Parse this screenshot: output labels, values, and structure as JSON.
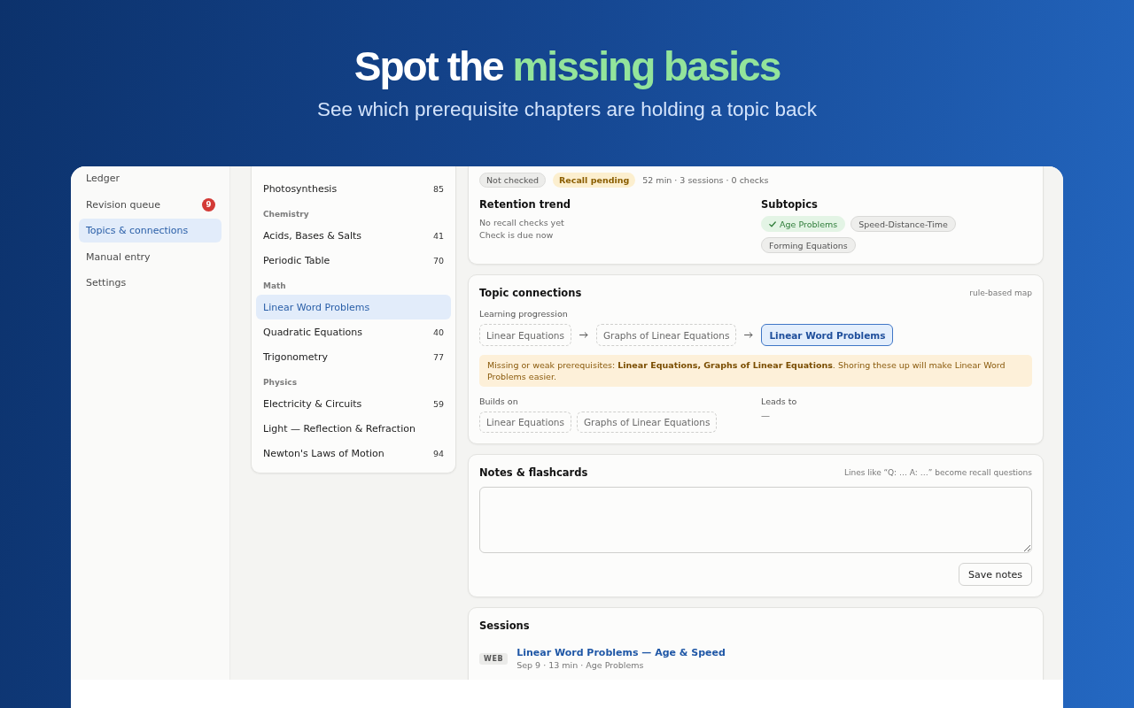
{
  "hero": {
    "title_lead": "Spot the",
    "title_highlight": "missing basics",
    "subtitle": "See which prerequisite chapters are holding a topic back"
  },
  "sidebar": {
    "items": [
      {
        "label": "Ledger",
        "selected": false
      },
      {
        "label": "Revision queue",
        "selected": false,
        "badge": "9"
      },
      {
        "label": "Topics & connections",
        "selected": true
      },
      {
        "label": "Manual entry",
        "selected": false
      },
      {
        "label": "Settings",
        "selected": false
      }
    ]
  },
  "topic_list": {
    "items": [
      {
        "kind": "topic",
        "label": "Photosynthesis",
        "score": "85",
        "selected": false
      },
      {
        "kind": "group",
        "label": "Chemistry"
      },
      {
        "kind": "topic",
        "label": "Acids, Bases & Salts",
        "score": "41",
        "selected": false
      },
      {
        "kind": "topic",
        "label": "Periodic Table",
        "score": "70",
        "selected": false
      },
      {
        "kind": "group",
        "label": "Math"
      },
      {
        "kind": "topic",
        "label": "Linear Word Problems",
        "selected": true
      },
      {
        "kind": "topic",
        "label": "Quadratic Equations",
        "score": "40",
        "selected": false
      },
      {
        "kind": "topic",
        "label": "Trigonometry",
        "score": "77",
        "selected": false
      },
      {
        "kind": "group",
        "label": "Physics"
      },
      {
        "kind": "topic",
        "label": "Electricity & Circuits",
        "score": "59",
        "selected": false
      },
      {
        "kind": "topic",
        "label": "Light — Reflection & Refraction",
        "selected": false
      },
      {
        "kind": "topic",
        "label": "Newton's Laws of Motion",
        "score": "94",
        "selected": false
      }
    ]
  },
  "summary": {
    "badges": [
      {
        "label": "Not checked",
        "kind": "neutral"
      },
      {
        "label": "Recall pending",
        "kind": "warning"
      }
    ],
    "stats": "52 min · 3 sessions · 0 checks",
    "retention": {
      "title": "Retention trend",
      "lines": [
        "No recall checks yet",
        "Check is due now"
      ]
    },
    "subtopics": {
      "title": "Subtopics",
      "items": [
        {
          "label": "Age Problems",
          "done": true
        },
        {
          "label": "Speed-Distance-Time",
          "done": false
        },
        {
          "label": "Forming Equations",
          "done": false
        }
      ]
    }
  },
  "connections": {
    "title": "Topic connections",
    "hint": "rule-based map",
    "progression_label": "Learning progression",
    "progression": [
      {
        "label": "Linear Equations",
        "current": false
      },
      {
        "label": "Graphs of Linear Equations",
        "current": false
      },
      {
        "label": "Linear Word Problems",
        "current": true
      }
    ],
    "warning": "Missing or weak prerequisites: **Linear Equations, Graphs of Linear Equations**. Shoring these up will make Linear Word Problems easier.",
    "builds_on": {
      "label": "Builds on",
      "items": [
        "Linear Equations",
        "Graphs of Linear Equations"
      ]
    },
    "leads_to": {
      "label": "Leads to",
      "value": "—"
    }
  },
  "notes": {
    "title": "Notes & flashcards",
    "hint": "Lines like “Q: … A: …” become recall questions",
    "button": "Save notes"
  },
  "sessions": {
    "title": "Sessions",
    "items": [
      {
        "source": "WEB",
        "title": "Linear Word Problems — Age & Speed",
        "meta": "Sep 9 · 13 min · Age Problems"
      }
    ]
  }
}
